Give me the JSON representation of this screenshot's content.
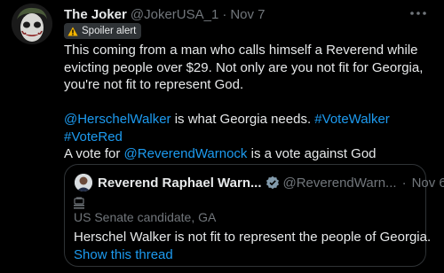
{
  "tweet": {
    "display_name": "The Joker",
    "handle": "@JokerUSA_1",
    "separator": "·",
    "time": "Nov 7",
    "spoiler_label": "Spoiler alert",
    "body_lines": [
      "This coming from a man who calls himself a Reverend while",
      "evicting people over $29.  Not only are you not fit for Georgia,",
      "you're not fit to represent God."
    ],
    "mention_1": "@HerschelWalker",
    "line4_text": " is what Georgia needs.  ",
    "hashtag_1": "#VoteWalker",
    "hashtag_2": "#VoteRed",
    "line6_prefix": "A vote for ",
    "mention_2": "@ReverendWarnock",
    "line6_suffix": " is a vote against God"
  },
  "quote": {
    "display_name": "Reverend Raphael Warn...",
    "handle": "@ReverendWarn...",
    "separator": "·",
    "time": "Nov 6",
    "label": "US Senate candidate, GA",
    "text": "Herschel Walker is not fit to represent the people of Georgia.",
    "show_thread": "Show this thread"
  },
  "icons": {
    "more": "more-icon",
    "warning": "warning-icon",
    "verified": "verified-badge-icon",
    "government": "government-label-icon"
  },
  "colors": {
    "background": "#000000",
    "text": "#e7e9ea",
    "muted": "#71767b",
    "link": "#1d9bf0",
    "border": "#2f3336",
    "spoiler_bg": "#2f3336"
  }
}
